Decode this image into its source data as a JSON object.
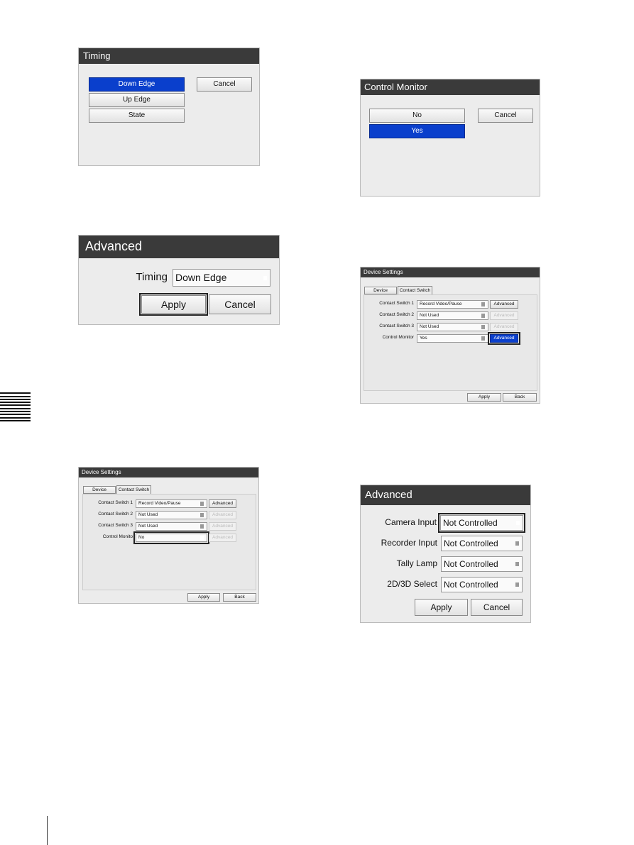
{
  "timing_dialog": {
    "title": "Timing",
    "options": [
      "Down Edge",
      "Up Edge",
      "State"
    ],
    "cancel": "Cancel"
  },
  "advanced_timing": {
    "title": "Advanced",
    "label": "Timing",
    "value": "Down Edge",
    "apply": "Apply",
    "cancel": "Cancel"
  },
  "control_monitor_dialog": {
    "title": "Control Monitor",
    "options": [
      "No",
      "Yes"
    ],
    "cancel": "Cancel"
  },
  "device_settings_1": {
    "title": "Device Settings",
    "tabs": [
      "Device",
      "Contact Switch"
    ],
    "rows": [
      {
        "label": "Contact Switch 1",
        "value": "Record Video/Pause"
      },
      {
        "label": "Contact Switch 2",
        "value": "Not Used"
      },
      {
        "label": "Contact Switch 3",
        "value": "Not Used"
      },
      {
        "label": "Control Monito",
        "value": "No"
      }
    ],
    "advanced": "Advanced",
    "apply": "Apply",
    "back": "Back"
  },
  "device_settings_2": {
    "title": "Device Settings",
    "tabs": [
      "Device",
      "Contact Switch"
    ],
    "rows": [
      {
        "label": "Contact Switch 1",
        "value": "Record Video/Pause"
      },
      {
        "label": "Contact Switch 2",
        "value": "Not Used"
      },
      {
        "label": "Contact Switch 3",
        "value": "Not Used"
      },
      {
        "label": "Control Monitor",
        "value": "Yes"
      }
    ],
    "advanced": "Advanced",
    "apply": "Apply",
    "back": "Back"
  },
  "advanced_monitor": {
    "title": "Advanced",
    "rows": [
      {
        "label": "Camera Input",
        "value": "Not Controlled"
      },
      {
        "label": "Recorder Input",
        "value": "Not Controlled"
      },
      {
        "label": "Tally Lamp",
        "value": "Not Controlled"
      },
      {
        "label": "2D/3D Select",
        "value": "Not Controlled"
      }
    ],
    "apply": "Apply",
    "cancel": "Cancel"
  },
  "colors": {
    "accent": "#0a3fcc",
    "titlebar": "#3a3a3a"
  }
}
